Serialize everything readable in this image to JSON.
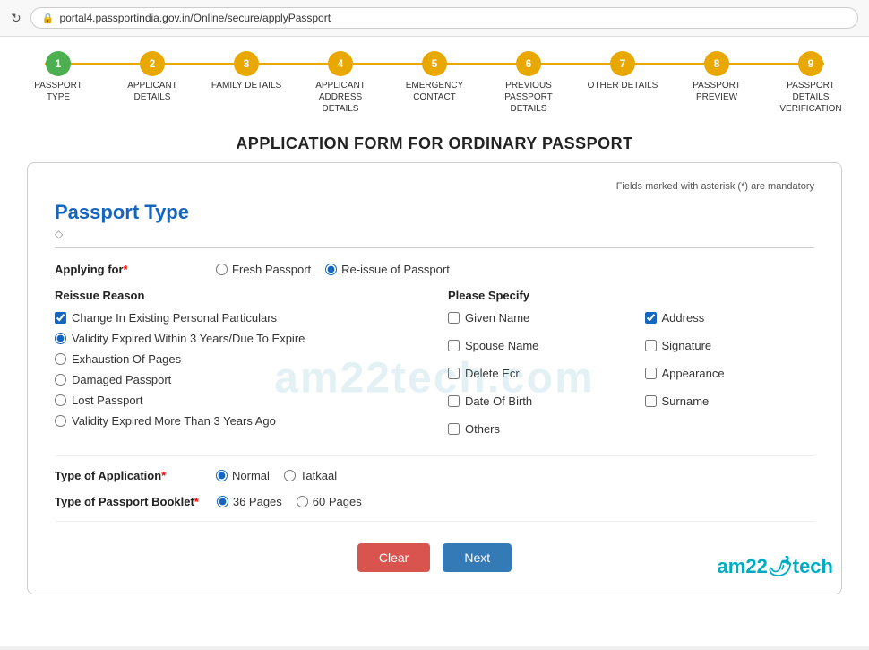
{
  "browser": {
    "url": "portal4.passportindia.gov.in/Online/secure/applyPassport",
    "refresh_icon": "↻",
    "lock_icon": "🔒"
  },
  "stepper": {
    "steps": [
      {
        "number": "1",
        "label": "PASSPORT TYPE",
        "state": "active"
      },
      {
        "number": "2",
        "label": "APPLICANT DETAILS",
        "state": "inactive"
      },
      {
        "number": "3",
        "label": "FAMILY DETAILS",
        "state": "inactive"
      },
      {
        "number": "4",
        "label": "APPLICANT ADDRESS DETAILS",
        "state": "inactive"
      },
      {
        "number": "5",
        "label": "EMERGENCY CONTACT",
        "state": "inactive"
      },
      {
        "number": "6",
        "label": "PREVIOUS PASSPORT DETAILS",
        "state": "inactive"
      },
      {
        "number": "7",
        "label": "OTHER DETAILS",
        "state": "inactive"
      },
      {
        "number": "8",
        "label": "PASSPORT PREVIEW",
        "state": "inactive"
      },
      {
        "number": "9",
        "label": "PASSPORT DETAILS VERIFICATION",
        "state": "inactive"
      }
    ]
  },
  "page": {
    "title": "APPLICATION FORM FOR ORDINARY PASSPORT"
  },
  "form": {
    "mandatory_note": "Fields marked with asterisk (*) are mandatory",
    "section_title": "Passport Type",
    "applying_for_label": "Applying for",
    "applying_for_options": [
      {
        "id": "fresh",
        "label": "Fresh Passport",
        "checked": false
      },
      {
        "id": "reissue",
        "label": "Re-issue of Passport",
        "checked": true
      }
    ],
    "reissue_reason": {
      "title": "Reissue Reason",
      "options": [
        {
          "label": "Change In Existing Personal Particulars",
          "type": "checkbox",
          "checked": true
        },
        {
          "label": "Validity Expired Within 3 Years/Due To Expire",
          "type": "radio",
          "checked": true
        },
        {
          "label": "Exhaustion Of Pages",
          "type": "radio",
          "checked": false
        },
        {
          "label": "Damaged Passport",
          "type": "radio",
          "checked": false
        },
        {
          "label": "Lost Passport",
          "type": "radio",
          "checked": false
        },
        {
          "label": "Validity Expired More Than 3 Years Ago",
          "type": "radio",
          "checked": false
        }
      ]
    },
    "please_specify": {
      "title": "Please Specify",
      "options": [
        {
          "label": "Given Name",
          "checked": false
        },
        {
          "label": "Address",
          "checked": true
        },
        {
          "label": "Spouse Name",
          "checked": false
        },
        {
          "label": "Signature",
          "checked": false
        },
        {
          "label": "Delete Ecr",
          "checked": false
        },
        {
          "label": "Appearance",
          "checked": false
        },
        {
          "label": "Date Of Birth",
          "checked": false
        },
        {
          "label": "Surname",
          "checked": false
        },
        {
          "label": "Others",
          "checked": false
        }
      ]
    },
    "type_of_application": {
      "label": "Type of Application",
      "options": [
        {
          "id": "normal",
          "label": "Normal",
          "checked": true
        },
        {
          "id": "tatkaal",
          "label": "Tatkaal",
          "checked": false
        }
      ]
    },
    "type_of_booklet": {
      "label": "Type of Passport Booklet",
      "options": [
        {
          "id": "36pages",
          "label": "36 Pages",
          "checked": true
        },
        {
          "id": "60pages",
          "label": "60 Pages",
          "checked": false
        }
      ]
    },
    "buttons": {
      "clear": "Clear",
      "next": "Next"
    }
  },
  "branding": {
    "text_before": "am22",
    "emoji": "🌶",
    "text_after": "tech"
  }
}
